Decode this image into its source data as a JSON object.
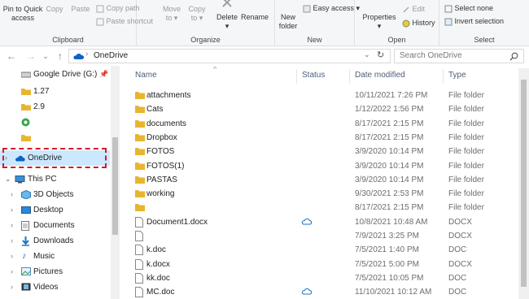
{
  "ribbon": {
    "clipboard": {
      "label": "Clipboard",
      "pin_quick": "Pin to Quick",
      "pin_access": "access",
      "copy": "Copy",
      "paste": "Paste",
      "copy_path": "Copy path",
      "paste_shortcut": "Paste shortcut"
    },
    "organize": {
      "label": "Organize",
      "move_to": "Move",
      "move_to2": "to",
      "copy_to": "Copy",
      "copy_to2": "to",
      "delete": "Delete",
      "rename": "Rename"
    },
    "new": {
      "label": "New",
      "new_folder": "New",
      "new_folder2": "folder",
      "easy_access": "Easy access"
    },
    "open": {
      "label": "Open",
      "properties": "Properties",
      "edit": "Edit",
      "history": "History"
    },
    "select": {
      "label": "Select",
      "select_none": "Select none",
      "invert_selection": "Invert selection"
    }
  },
  "address": {
    "path": "OneDrive",
    "search_placeholder": "Search OneDrive"
  },
  "nav": {
    "items": [
      {
        "label": "Google Drive (G:)"
      },
      {
        "label": "1.27"
      },
      {
        "label": "2.9"
      },
      {
        "label": ""
      },
      {
        "label": ""
      },
      {
        "label": "OneDrive"
      },
      {
        "label": "This PC"
      },
      {
        "label": "3D Objects"
      },
      {
        "label": "Desktop"
      },
      {
        "label": "Documents"
      },
      {
        "label": "Downloads"
      },
      {
        "label": "Music"
      },
      {
        "label": "Pictures"
      },
      {
        "label": "Videos"
      }
    ]
  },
  "columns": {
    "name": "Name",
    "status": "Status",
    "date": "Date modified",
    "type": "Type"
  },
  "files": [
    {
      "name": "attachments",
      "date": "10/11/2021 7:26 PM",
      "type": "File folder",
      "kind": "folder",
      "cloud": false
    },
    {
      "name": "Cats",
      "date": "1/12/2022 1:56 PM",
      "type": "File folder",
      "kind": "folder",
      "cloud": false
    },
    {
      "name": "documents",
      "date": "8/17/2021 2:15 PM",
      "type": "File folder",
      "kind": "folder",
      "cloud": false
    },
    {
      "name": "Dropbox",
      "date": "8/17/2021 2:15 PM",
      "type": "File folder",
      "kind": "folder",
      "cloud": false
    },
    {
      "name": "FOTOS",
      "date": "3/9/2020 10:14 PM",
      "type": "File folder",
      "kind": "folder",
      "cloud": false
    },
    {
      "name": "FOTOS(1)",
      "date": "3/9/2020 10:14 PM",
      "type": "File folder",
      "kind": "folder",
      "cloud": false
    },
    {
      "name": "PASTAS",
      "date": "3/9/2020 10:14 PM",
      "type": "File folder",
      "kind": "folder",
      "cloud": false
    },
    {
      "name": "working",
      "date": "9/30/2021 2:53 PM",
      "type": "File folder",
      "kind": "folder",
      "cloud": false
    },
    {
      "name": "",
      "date": "8/17/2021 2:15 PM",
      "type": "File folder",
      "kind": "folder",
      "cloud": false
    },
    {
      "name": "Document1.docx",
      "date": "10/8/2021 10:48 AM",
      "type": "DOCX",
      "kind": "doc",
      "cloud": true
    },
    {
      "name": "",
      "date": "7/9/2021 3:25 PM",
      "type": "DOCX",
      "kind": "doc",
      "cloud": false
    },
    {
      "name": "k.doc",
      "date": "7/5/2021 1:40 PM",
      "type": "DOC",
      "kind": "doc",
      "cloud": false
    },
    {
      "name": "k.docx",
      "date": "7/5/2021 5:00 PM",
      "type": "DOCX",
      "kind": "doc",
      "cloud": false
    },
    {
      "name": "kk.doc",
      "date": "7/5/2021 10:05 PM",
      "type": "DOC",
      "kind": "doc",
      "cloud": false
    },
    {
      "name": "MC.doc",
      "date": "11/10/2021 10:12 AM",
      "type": "DOC",
      "kind": "doc",
      "cloud": true
    }
  ],
  "colors": {
    "accent": "#0078d7",
    "highlight": "#cce8ff",
    "folder": "#e8b530",
    "annotation": "#d11a2a"
  }
}
